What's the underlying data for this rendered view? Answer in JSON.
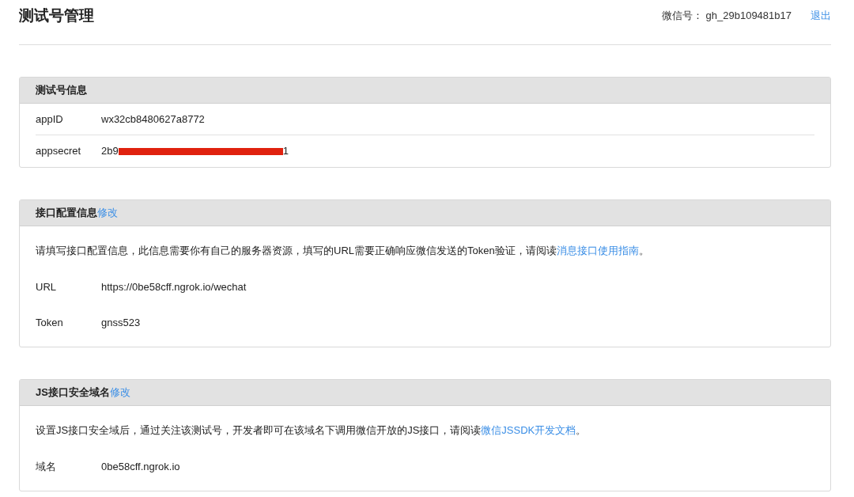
{
  "header": {
    "title": "测试号管理",
    "account_label": "微信号：",
    "account_id": "gh_29b109481b17",
    "logout": "退出"
  },
  "panels": [
    {
      "title": "测试号信息",
      "rows": [
        {
          "label": "appID",
          "value": "wx32cb8480627a8772"
        },
        {
          "label": "appsecret",
          "value": "2b9",
          "redacted": true,
          "value_end": "1"
        }
      ]
    },
    {
      "title": "接口配置信息",
      "edit_link": "修改",
      "description": {
        "text": "请填写接口配置信息，此信息需要你有自己的服务器资源，填写的URL需要正确响应微信发送的Token验证，请阅读",
        "link": "消息接口使用指南",
        "after": "。"
      },
      "rows": [
        {
          "label": "URL",
          "value": "https://0be58cff.ngrok.io/wechat"
        },
        {
          "label": "Token",
          "value": "gnss523"
        }
      ]
    },
    {
      "title": "JS接口安全域名",
      "edit_link": "修改",
      "description": {
        "text": "设置JS接口安全域后，通过关注该测试号，开发者即可在该域名下调用微信开放的JS接口，请阅读",
        "link": "微信JSSDK开发文档",
        "after": "。"
      },
      "rows": [
        {
          "label": "域名",
          "value": "0be58cff.ngrok.io"
        }
      ]
    }
  ]
}
